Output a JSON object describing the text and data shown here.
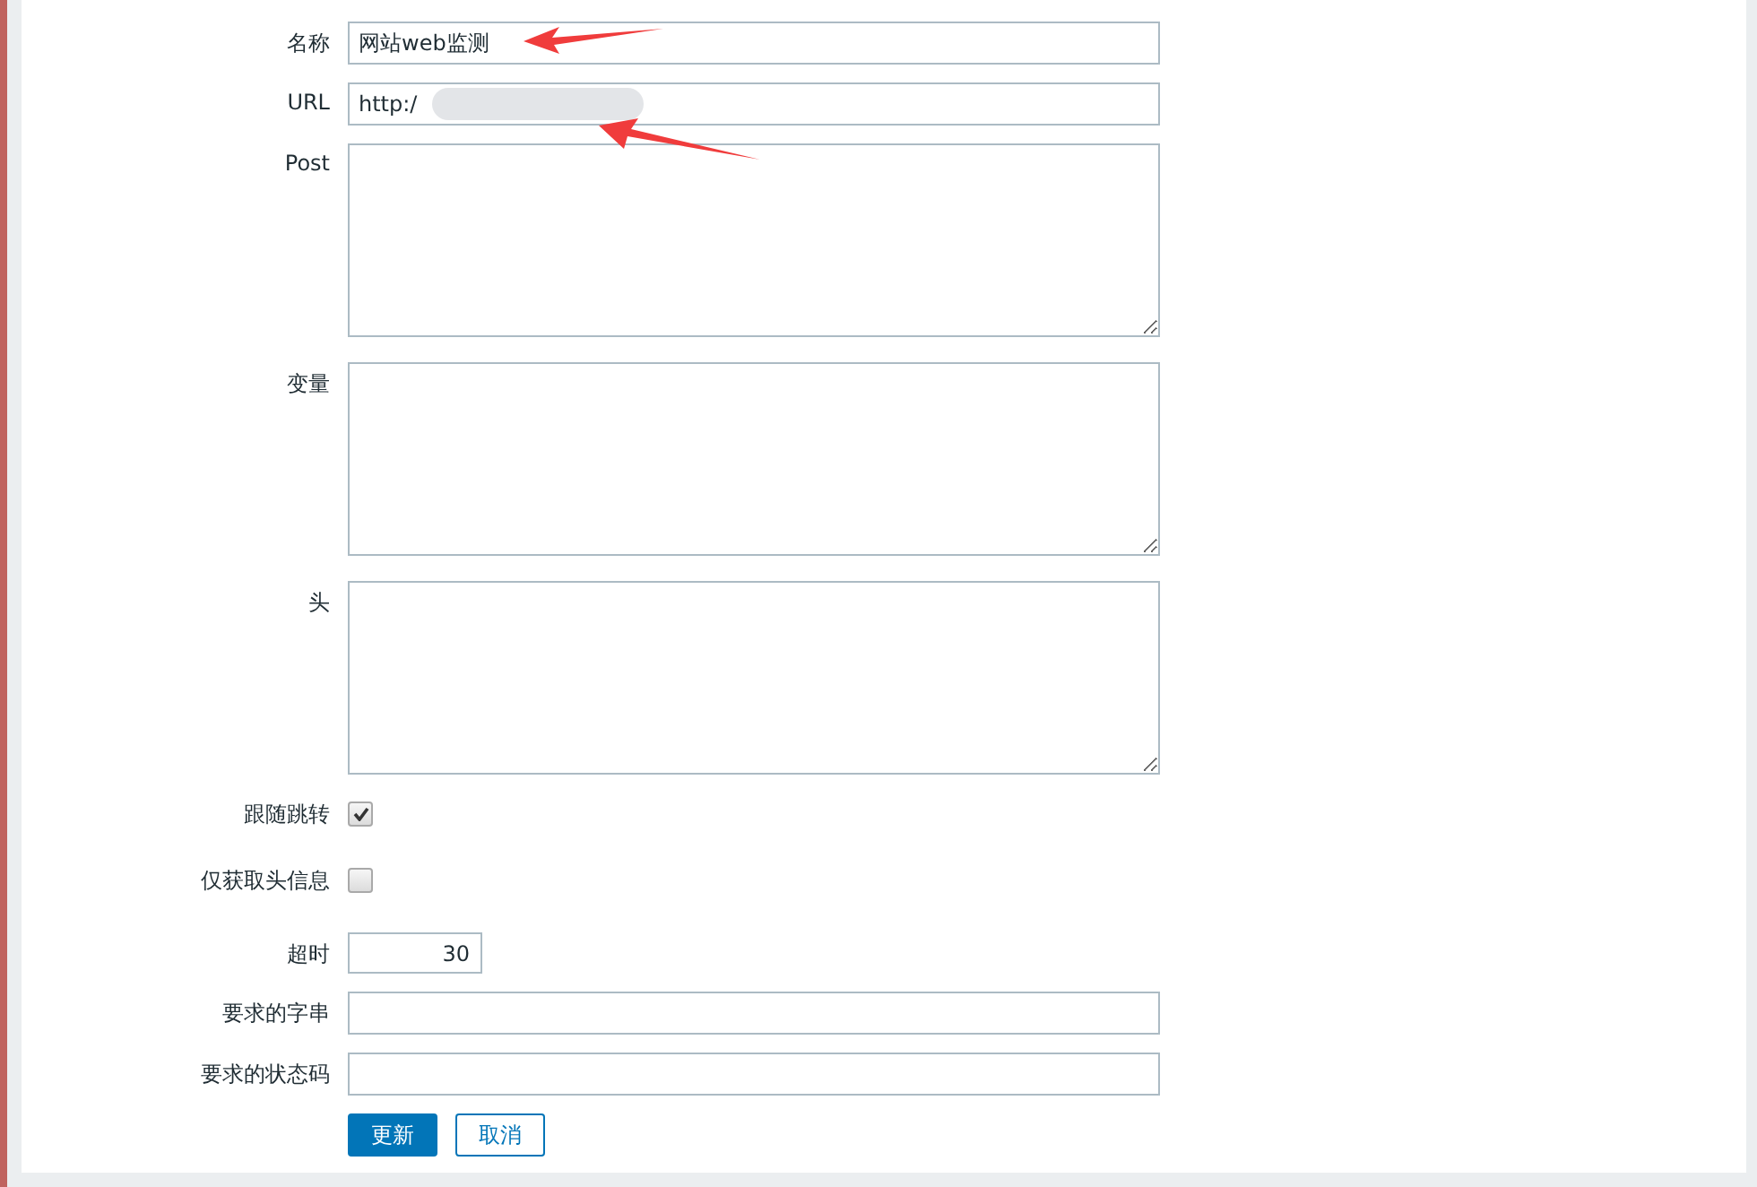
{
  "fields": [
    {
      "kind": "text",
      "label": "名称",
      "value": "网站web监测",
      "annotated": true
    },
    {
      "kind": "text",
      "label": "URL",
      "value": "http:/",
      "blurred": true,
      "annotated": true
    },
    {
      "kind": "textarea",
      "label": "Post"
    },
    {
      "kind": "textarea",
      "label": "变量"
    },
    {
      "kind": "textarea",
      "label": "头"
    },
    {
      "kind": "checkbox",
      "label": "跟随跳转",
      "checked": true
    },
    {
      "kind": "checkbox",
      "label": "仅获取头信息",
      "checked": false
    },
    {
      "kind": "number",
      "label": "超时",
      "value": "30"
    },
    {
      "kind": "text",
      "label": "要求的字串"
    },
    {
      "kind": "text",
      "label": "要求的状态码"
    }
  ],
  "buttons": [
    {
      "label": "更新",
      "primary": true
    },
    {
      "label": "取消",
      "primary": false
    }
  ]
}
